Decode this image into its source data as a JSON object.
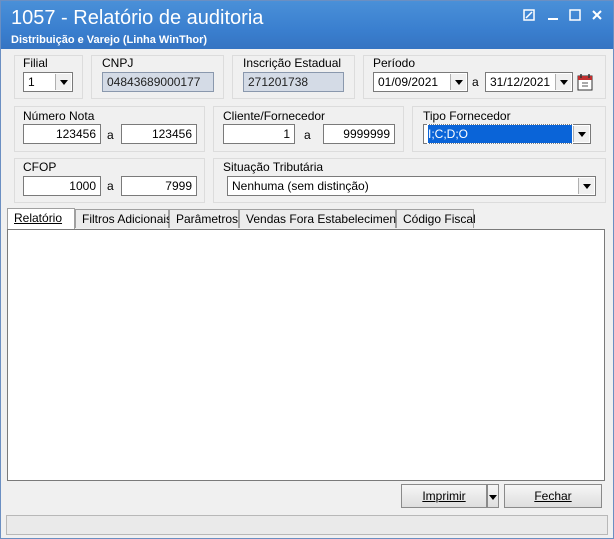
{
  "window": {
    "title": "1057 - Relatório de auditoria",
    "subtitle": "Distribuição e Varejo (Linha WinThor)"
  },
  "filial": {
    "label": "Filial",
    "value": "1"
  },
  "cnpj": {
    "label": "CNPJ",
    "value": "04843689000177"
  },
  "inscricao": {
    "label": "Inscrição Estadual",
    "value": "271201738"
  },
  "periodo": {
    "label": "Período",
    "from": "01/09/2021",
    "sep": "a",
    "to": "31/12/2021"
  },
  "numero_nota": {
    "label": "Número Nota",
    "from": "123456",
    "sep": "a",
    "to": "123456"
  },
  "cliente": {
    "label": "Cliente/Fornecedor",
    "from": "1",
    "sep": "a",
    "to": "9999999"
  },
  "tipo_fornecedor": {
    "label": "Tipo Fornecedor",
    "value": "I;C;D;O"
  },
  "cfop": {
    "label": "CFOP",
    "from": "1000",
    "sep": "a",
    "to": "7999"
  },
  "situacao": {
    "label": "Situação Tributária",
    "value": "Nenhuma (sem distinção)"
  },
  "tabs": [
    {
      "label": "Relatório"
    },
    {
      "label": "Filtros Adicionais"
    },
    {
      "label": "Parâmetros"
    },
    {
      "label": "Vendas Fora Estabelecimento"
    },
    {
      "label": "Código Fiscal"
    }
  ],
  "buttons": {
    "imprimir": "Imprimir",
    "fechar": "Fechar"
  },
  "colors": {
    "titlebar": "#3a7fcf",
    "selection": "#0a64d8"
  }
}
